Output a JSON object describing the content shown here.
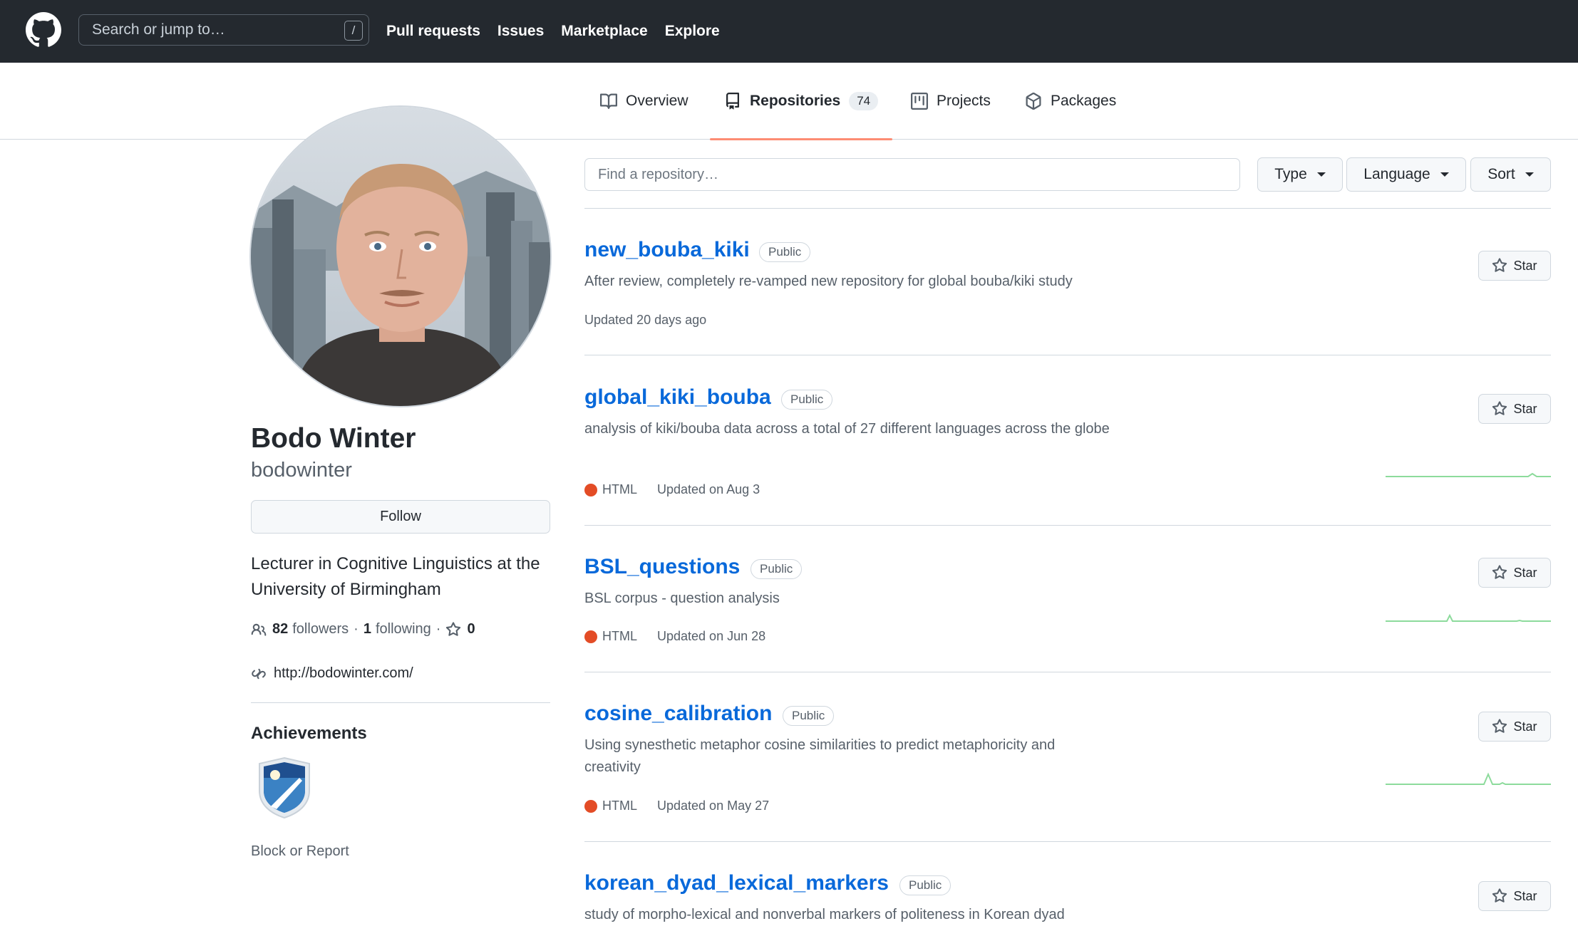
{
  "header": {
    "search_placeholder": "Search or jump to…",
    "search_shortcut": "/",
    "nav": [
      "Pull requests",
      "Issues",
      "Marketplace",
      "Explore"
    ]
  },
  "tabs": {
    "overview": "Overview",
    "repositories": "Repositories",
    "repositories_count": "74",
    "projects": "Projects",
    "packages": "Packages"
  },
  "profile": {
    "name": "Bodo Winter",
    "login": "bodowinter",
    "follow_label": "Follow",
    "bio": "Lecturer in Cognitive Linguistics at the University of Birmingham",
    "followers_count": "82",
    "followers_label": "followers",
    "following_count": "1",
    "following_label": "following",
    "stars_count": "0",
    "website": "http://bodowinter.com/",
    "achievements_title": "Achievements",
    "block_label": "Block or Report"
  },
  "controls": {
    "find_placeholder": "Find a repository…",
    "type_label": "Type",
    "language_label": "Language",
    "sort_label": "Sort"
  },
  "repos": [
    {
      "name": "new_bouba_kiki",
      "visibility": "Public",
      "description": "After review, completely re-vamped new repository for global bouba/kiki study",
      "language": "",
      "updated": "Updated 20 days ago",
      "star_label": "Star"
    },
    {
      "name": "global_kiki_bouba",
      "visibility": "Public",
      "description": "analysis of kiki/bouba data across a total of 27 different languages across the globe",
      "language": "HTML",
      "updated": "Updated on Aug 3",
      "star_label": "Star"
    },
    {
      "name": "BSL_questions",
      "visibility": "Public",
      "description": "BSL corpus - question analysis",
      "language": "HTML",
      "updated": "Updated on Jun 28",
      "star_label": "Star"
    },
    {
      "name": "cosine_calibration",
      "visibility": "Public",
      "description": "Using synesthetic metaphor cosine similarities to predict metaphoricity and creativity",
      "language": "HTML",
      "updated": "Updated on May 27",
      "star_label": "Star"
    },
    {
      "name": "korean_dyad_lexical_markers",
      "visibility": "Public",
      "description": "study of morpho-lexical and nonverbal markers of politeness in Korean dyad",
      "language": "",
      "updated": "",
      "star_label": "Star"
    }
  ],
  "colors": {
    "header_bg": "#24292f",
    "link": "#0969da",
    "tab_underline": "#fd8c73",
    "html_language": "#e34c26",
    "sparkline": "#8ddb9c"
  },
  "icons": {
    "logo": "github-mark-icon",
    "overview": "book-icon",
    "repositories": "repo-icon",
    "projects": "project-icon",
    "packages": "package-icon",
    "people": "people-icon",
    "star": "star-icon",
    "link": "link-icon"
  }
}
